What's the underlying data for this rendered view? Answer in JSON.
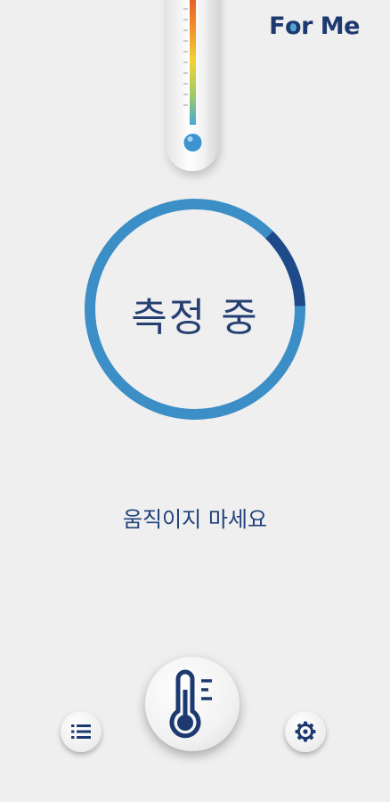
{
  "app": {
    "brand_prefix": "F",
    "brand_o": "o",
    "brand_suffix": "r Me"
  },
  "measurement": {
    "status_label": "측정 중",
    "instruction": "움직이지 마세요",
    "progress_fraction": 0.12
  },
  "colors": {
    "ring_main": "#3b8ec6",
    "ring_progress": "#1e4a8a",
    "text_primary": "#21427a",
    "icon_dark": "#1c3a70"
  },
  "icons": {
    "top_indicator": "thermometer-scale-icon",
    "list_button": "list-icon",
    "measure_button": "thermometer-icon",
    "settings_button": "gear-icon"
  }
}
